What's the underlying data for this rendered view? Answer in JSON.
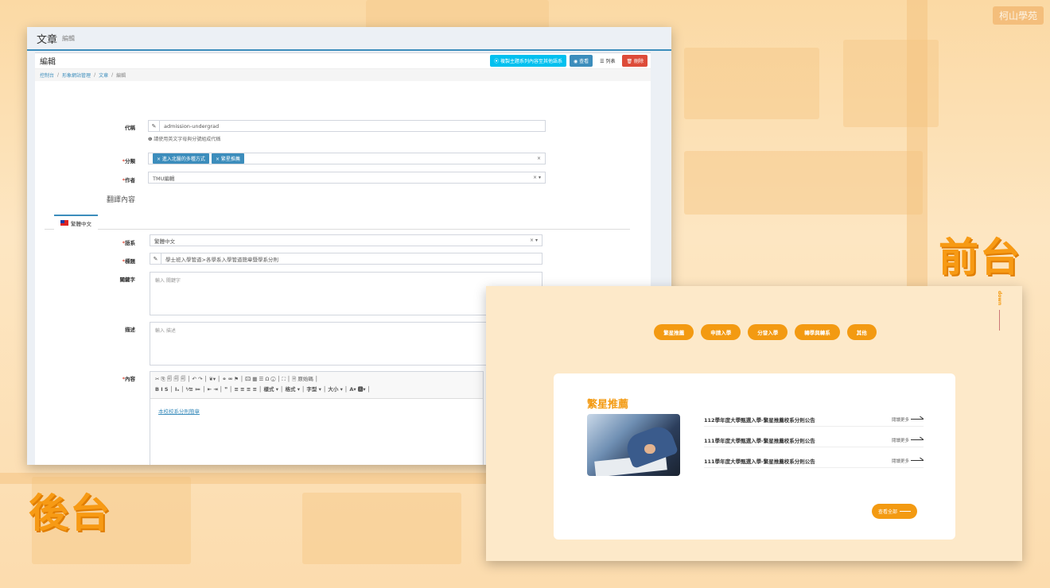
{
  "background": {
    "corner_tag": "柯山學苑"
  },
  "labels": {
    "front": "前台",
    "back": "後台"
  },
  "backend": {
    "header_title": "文章",
    "header_sub": "編輯",
    "panel_title": "編輯",
    "buttons": {
      "copy": "⦿ 複製主題系列內容至其他語系",
      "view": "◉ 查看",
      "list": "☰ 列表",
      "delete": "🗑 刪除"
    },
    "breadcrumb": [
      "控制台",
      "形象網站管理",
      "文章",
      "編輯"
    ],
    "form": {
      "code_label": "代稱",
      "code_value": "admission-undergrad",
      "code_help": "❶ 請使用英文字母與分號組成代稱",
      "category_label": "分類",
      "category_tags": [
        "× 進入北醫的多種方式",
        "× 繁星推薦"
      ],
      "author_label": "作者",
      "author_value": "TMU編輯",
      "translation_title": "翻譯內容",
      "tab_label": "繁體中文",
      "lang_label": "語系",
      "lang_value": "繁體中文",
      "title_label": "標題",
      "title_value": "學士班入學管道>各學系入學管道簡章暨學系分則",
      "keyword_label": "關鍵字",
      "keyword_placeholder": "輸入 關鍵字",
      "desc_label": "描述",
      "desc_placeholder": "輸入 描述",
      "content_label": "內容",
      "toolbar_row1": "✂ ⎘ 🗐 🗐 🗐 │ ↶ ↷ │ ❦▾ │ ⚭ ⚮ ⚑ │ 🖾 ▦ ☰ Ω ⓢ │ ⛶ │ 🗎 原始碼 │",
      "toolbar_row2": "B I S │ Iₓ │ ⅟≡ ≔ │ ⇤ ⇥ │ ❞ │ ≡ ≡ ≡ ≡ │ 樣式 ▾ │ 格式 ▾ │ 字型 ▾ │ 大小 ▾ │ A▾ 🅰▾ │",
      "content_link": "本校校系分則簡章"
    }
  },
  "frontend": {
    "side_text": "down",
    "nav": [
      "繁星推薦",
      "申請入學",
      "分發入學",
      "轉學與轉系",
      "其他"
    ],
    "section_title": "繁星推薦",
    "news": [
      {
        "title": "112學年度大學甄選入學-繁星推薦校系分則公告",
        "more": "閱讀更多"
      },
      {
        "title": "111學年度大學甄選入學-繁星推薦校系分則公告",
        "more": "閱讀更多"
      },
      {
        "title": "111學年度大學甄選入學-繁星推薦校系分則公告",
        "more": "閱讀更多"
      }
    ],
    "view_all": "查看全部"
  }
}
